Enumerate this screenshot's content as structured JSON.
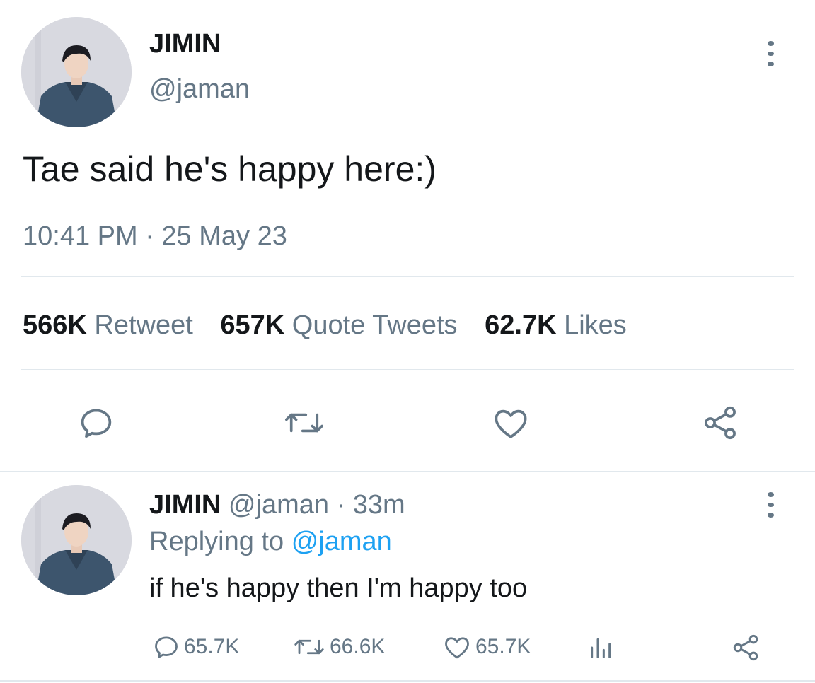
{
  "tweet": {
    "author_name": "JIMIN",
    "author_handle": "@jaman",
    "text": "Tae said he's happy here:)",
    "timestamp": "10:41 PM · 25 May 23",
    "stats": [
      {
        "count": "566K",
        "label": "Retweet"
      },
      {
        "count": "657K",
        "label": "Quote Tweets"
      },
      {
        "count": "62.7K",
        "label": "Likes"
      }
    ],
    "actions": [
      "reply-icon",
      "retweet-icon",
      "like-icon",
      "share-icon"
    ]
  },
  "reply": {
    "author_name": "JIMIN",
    "author_handle": "@jaman",
    "time": "· 33m",
    "replying_prefix": "Replying to",
    "replying_handle": "@jaman",
    "text": "if he's happy then I'm happy too",
    "reply_count": "65.7K",
    "retweet_count": "66.6K",
    "like_count": "65.7K",
    "actions": [
      "reply-icon",
      "retweet-icon",
      "like-icon",
      "analytics-icon",
      "share-icon"
    ]
  },
  "colors": {
    "text": "#14171a",
    "muted": "#657786",
    "link": "#1da1f2",
    "divider": "#e1e8ed"
  }
}
